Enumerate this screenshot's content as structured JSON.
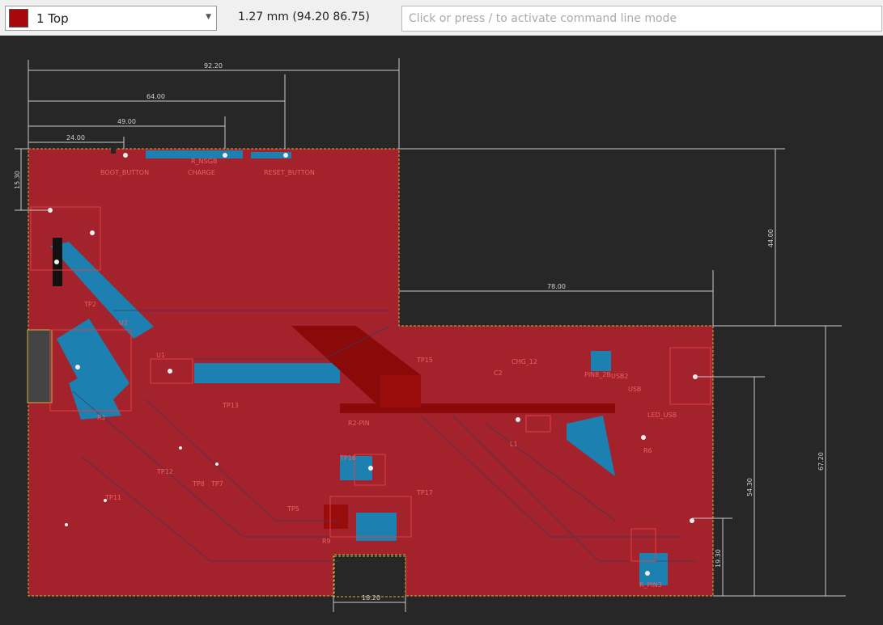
{
  "toolbar": {
    "layer_name": "1 Top",
    "layer_color": "#a8070d",
    "coordinates": "1.27 mm (94.20 86.75)",
    "command_placeholder": "Click or press / to activate command line mode"
  },
  "canvas": {
    "background": "#272727",
    "copper_color": "#a3222b",
    "trace_color": "#1c80b0",
    "dimension_color": "#c8c8c8"
  },
  "dimensions": {
    "d1": "92.20",
    "d2": "64.00",
    "d3": "49.00",
    "d4": "24.00",
    "d5": "15.30",
    "d6": "44.00",
    "d7": "78.00",
    "d8": "67.20",
    "d9": "54.30",
    "d10": "19.30",
    "d11": "18.20"
  },
  "labels": {
    "boot_button": "BOOT_BUTTON",
    "charge": "CHARGE",
    "reset_button": "RESET_BUTTON",
    "r_nsgb": "R_NSGB",
    "tp2": "TP2",
    "u1": "U1",
    "u2": "U2",
    "r1": "R1",
    "tp15": "TP15",
    "r2_pin": "R2-PIN",
    "tp13": "TP13",
    "tp12": "TP12",
    "tp8": "TP8",
    "tp7": "TP7",
    "tp11": "TP11",
    "tp17": "TP17",
    "tp5": "TP5",
    "tp16": "TP16",
    "chg": "CHG_12",
    "usb": "USB",
    "usb2": "USB2",
    "pin8": "PIN8_2B",
    "led": "LED_USB",
    "l1": "L1",
    "c2": "C2",
    "r6": "R6",
    "r9": "R9",
    "rpin3": "R_PIN3"
  }
}
